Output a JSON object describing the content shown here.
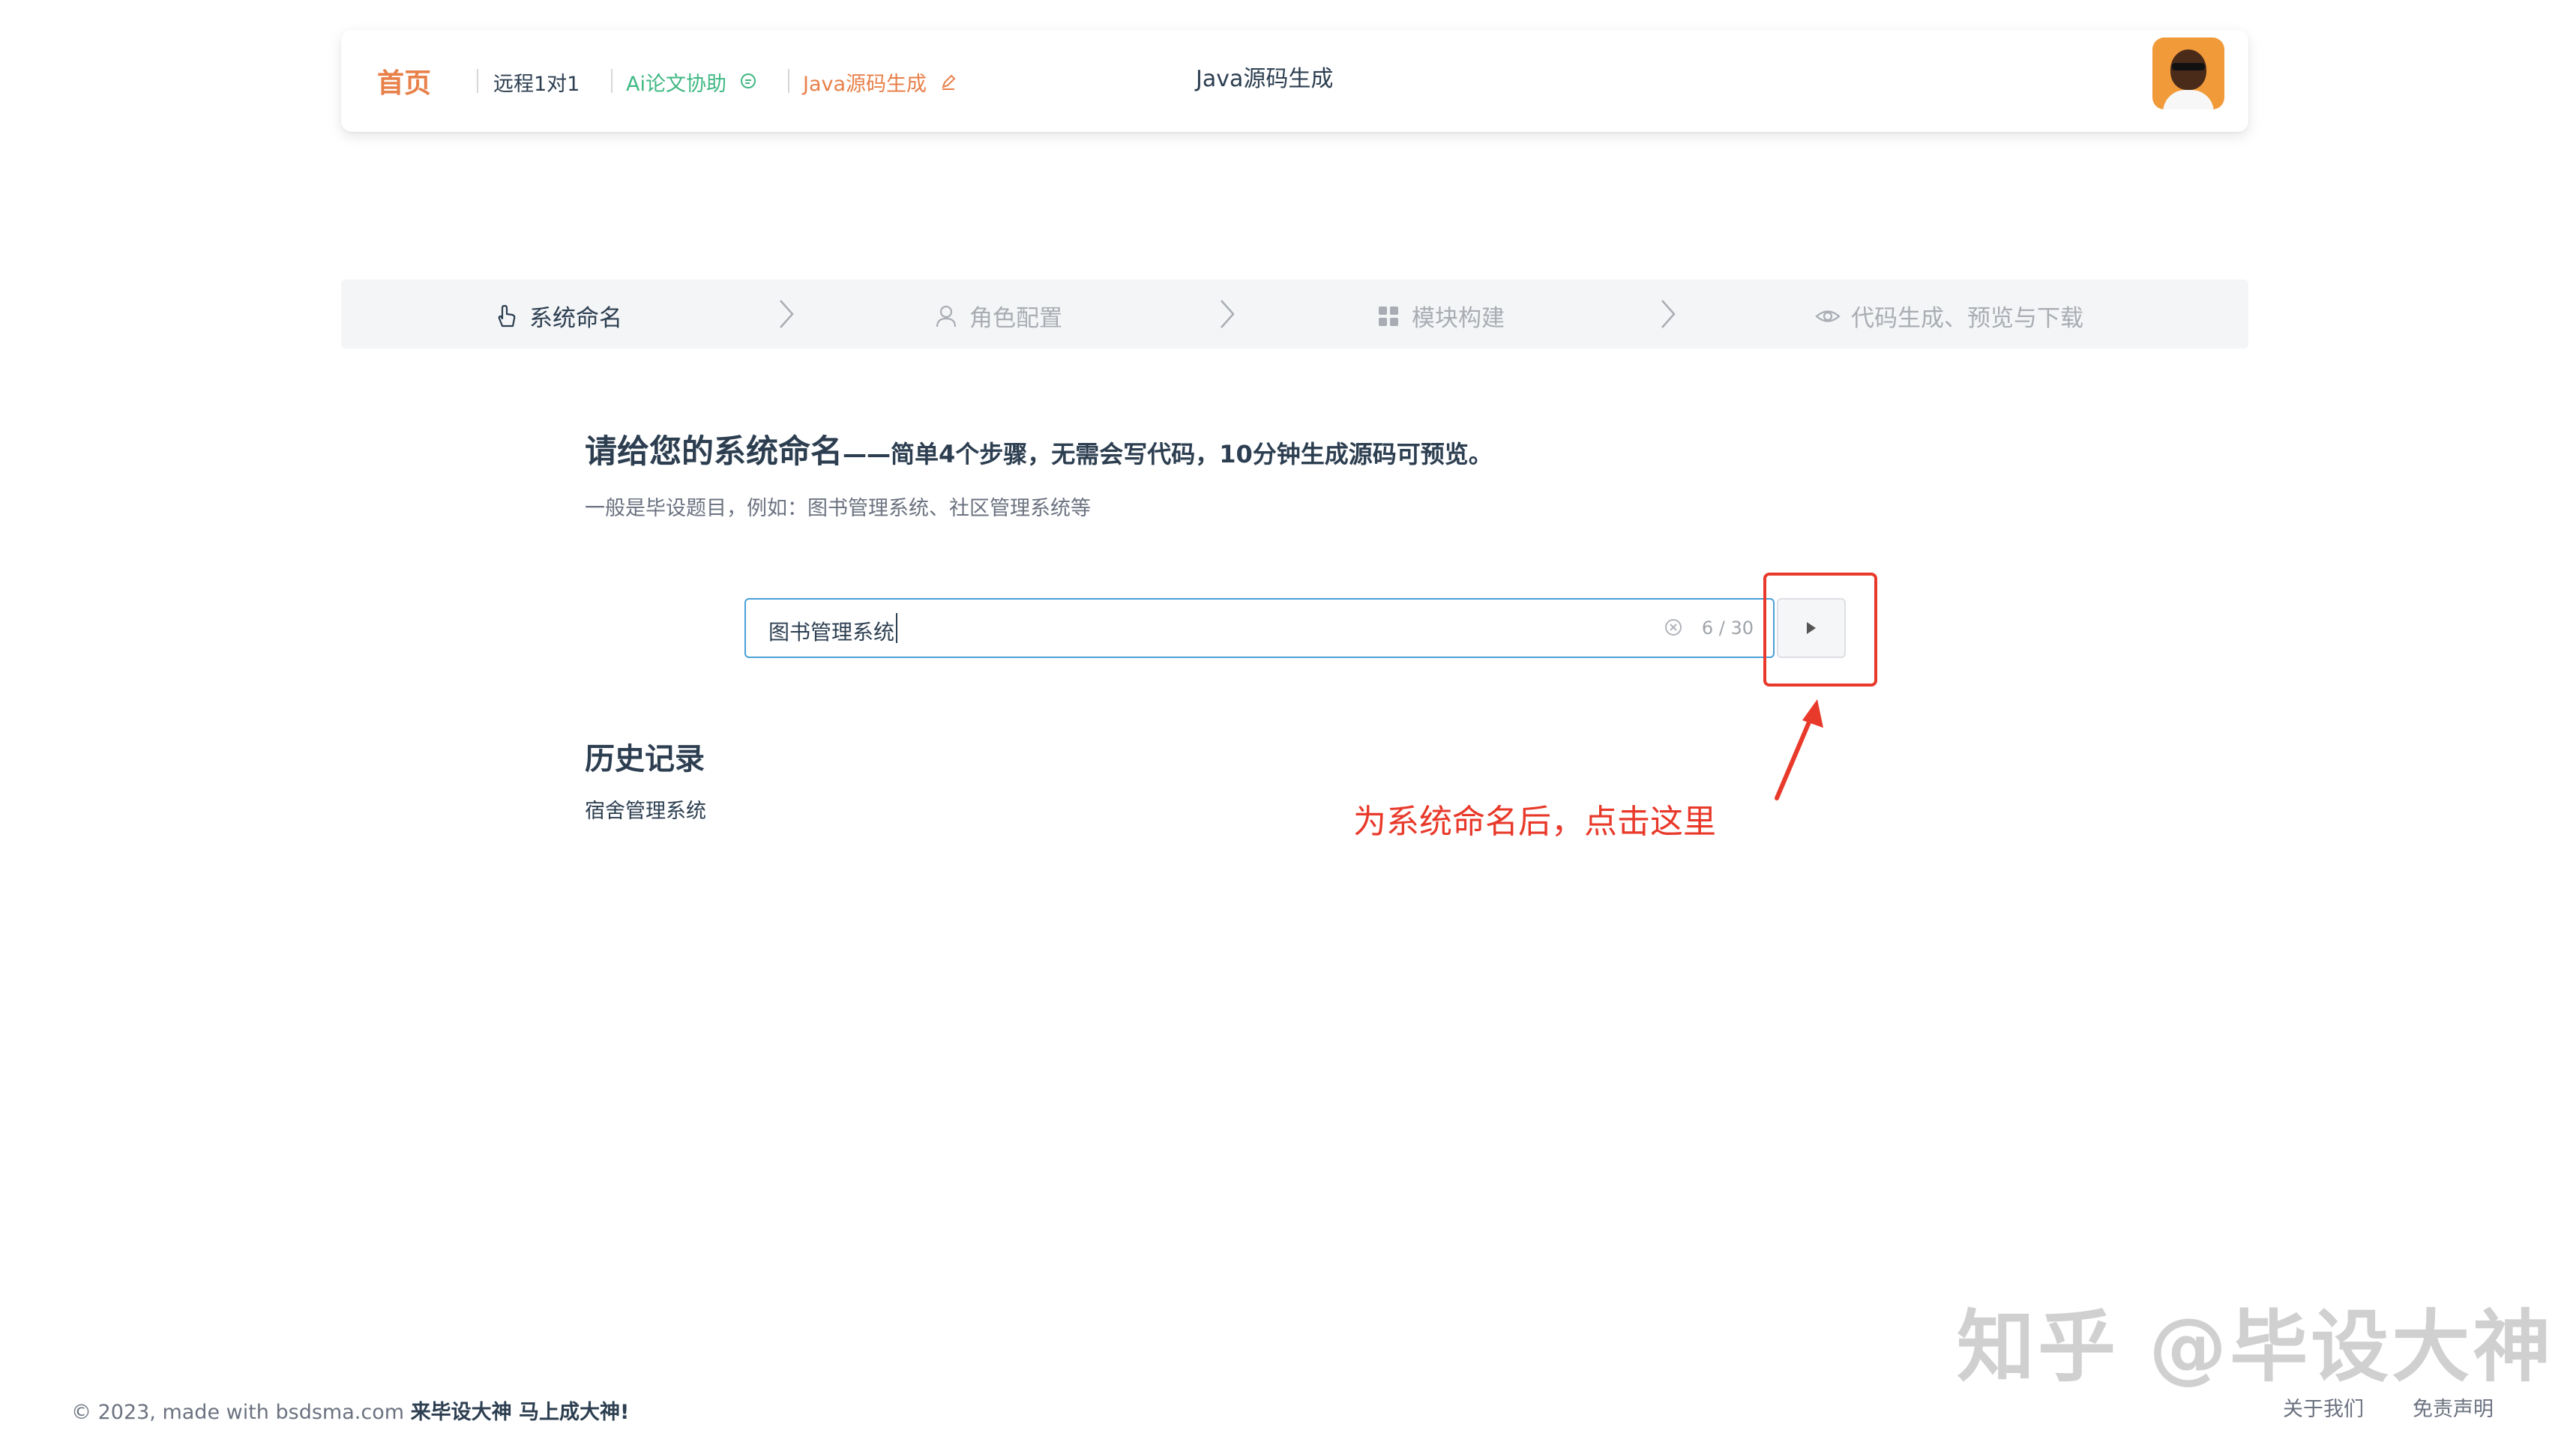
{
  "header": {
    "nav": {
      "home": "首页",
      "remote": "远程1对1",
      "ai": "Ai论文协助",
      "java": "Java源码生成"
    },
    "center_title": "Java源码生成"
  },
  "steps": [
    {
      "label": "系统命名",
      "icon": "pointer-hand-icon",
      "active": true
    },
    {
      "label": "角色配置",
      "icon": "user-icon",
      "active": false
    },
    {
      "label": "模块构建",
      "icon": "grid-icon",
      "active": false
    },
    {
      "label": "代码生成、预览与下载",
      "icon": "eye-icon",
      "active": false
    }
  ],
  "main": {
    "title": "请给您的系统命名",
    "title_tail": "——简单4个步骤，无需会写代码，10分钟生成源码可预览。",
    "subtitle": "一般是毕设题目，例如：图书管理系统、社区管理系统等"
  },
  "input": {
    "value": "图书管理系统",
    "count": "6 / 30"
  },
  "annotation": {
    "text": "为系统命名后，点击这里"
  },
  "history": {
    "title": "历史记录",
    "items": [
      "宿舍管理系统"
    ]
  },
  "footer": {
    "copyright": "© 2023, made with bsdsma.com",
    "slogan": "来毕设大神 马上成大神!",
    "about": "关于我们",
    "disclaimer": "免责声明"
  },
  "watermark": "知乎 @毕设大神",
  "colors": {
    "accent_orange": "#e8804a",
    "accent_green": "#3fb883",
    "annotation_red": "#e8392a",
    "input_border": "#4aa0d8"
  }
}
